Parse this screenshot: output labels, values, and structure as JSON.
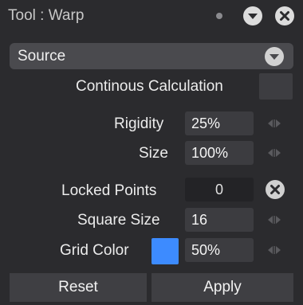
{
  "header": {
    "title": "Tool : Warp"
  },
  "source": {
    "label": "Source"
  },
  "continuous": {
    "label": "Continous Calculation"
  },
  "rigidity": {
    "label": "Rigidity",
    "value": "25%"
  },
  "size": {
    "label": "Size",
    "value": "100%"
  },
  "locked_points": {
    "label": "Locked Points",
    "value": "0"
  },
  "square_size": {
    "label": "Square Size",
    "value": "16"
  },
  "grid_color": {
    "label": "Grid Color",
    "color": "#3d8bff",
    "opacity": "50%"
  },
  "buttons": {
    "reset": "Reset",
    "apply": "Apply"
  }
}
